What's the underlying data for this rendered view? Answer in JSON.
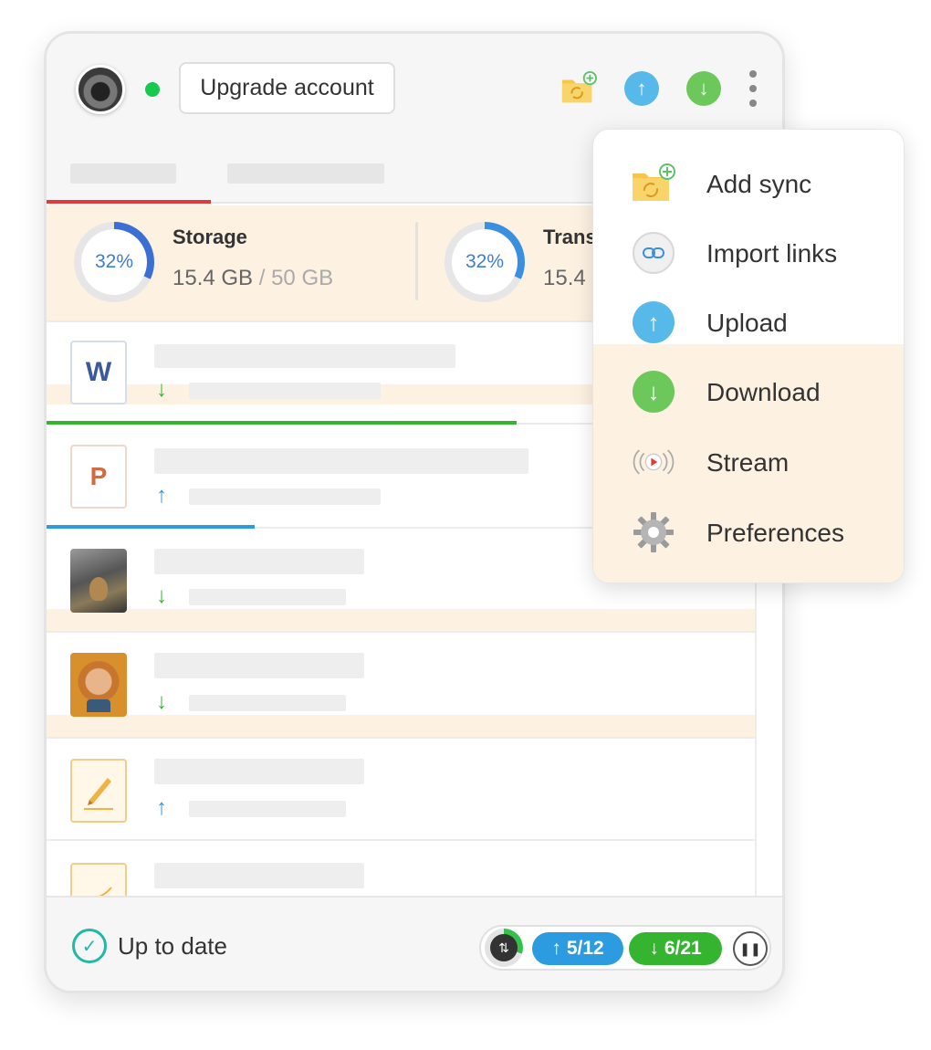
{
  "header": {
    "upgrade_label": "Upgrade account",
    "online_color": "#17c94c",
    "icons": [
      "add-sync-folder-icon",
      "upload-icon",
      "download-icon",
      "more-icon"
    ]
  },
  "usage": {
    "storage": {
      "title": "Storage",
      "percent_label": "32%",
      "percent": 32,
      "used": "15.4 GB",
      "separator": " / ",
      "total": "50 GB"
    },
    "transfer": {
      "title": "Trans",
      "percent_label": "32%",
      "percent": 32,
      "used": "15.4"
    }
  },
  "files": [
    {
      "type": "word",
      "letter": "W",
      "direction": "download",
      "arrow": "↓",
      "progress": 0.66,
      "progress_color": "#35b52f"
    },
    {
      "type": "powerpoint",
      "letter": "P",
      "direction": "upload",
      "arrow": "↑",
      "progress": 0.29,
      "progress_color": "#2d9be0"
    },
    {
      "type": "photo",
      "direction": "download",
      "arrow": "↓"
    },
    {
      "type": "photo",
      "direction": "download",
      "arrow": "↓"
    },
    {
      "type": "document",
      "direction": "upload",
      "arrow": "↑"
    },
    {
      "type": "document",
      "direction": "download"
    }
  ],
  "footer": {
    "status": "Up to date",
    "uploads": "5/12",
    "downloads": "6/21",
    "upload_arrow": "↑",
    "download_arrow": "↓"
  },
  "menu": {
    "items": [
      {
        "label": "Add sync",
        "icon": "add-sync-folder-icon"
      },
      {
        "label": "Import links",
        "icon": "link-icon"
      },
      {
        "label": "Upload",
        "icon": "upload-icon"
      },
      {
        "label": "Download",
        "icon": "download-icon"
      },
      {
        "label": "Stream",
        "icon": "stream-icon"
      },
      {
        "label": "Preferences",
        "icon": "gear-icon"
      }
    ]
  },
  "colors": {
    "accent_red": "#e53935",
    "upload_blue": "#2d9be0",
    "download_green": "#35b52f",
    "highlight": "#fdf1e1",
    "up_to_date_teal": "#22b8a8"
  }
}
